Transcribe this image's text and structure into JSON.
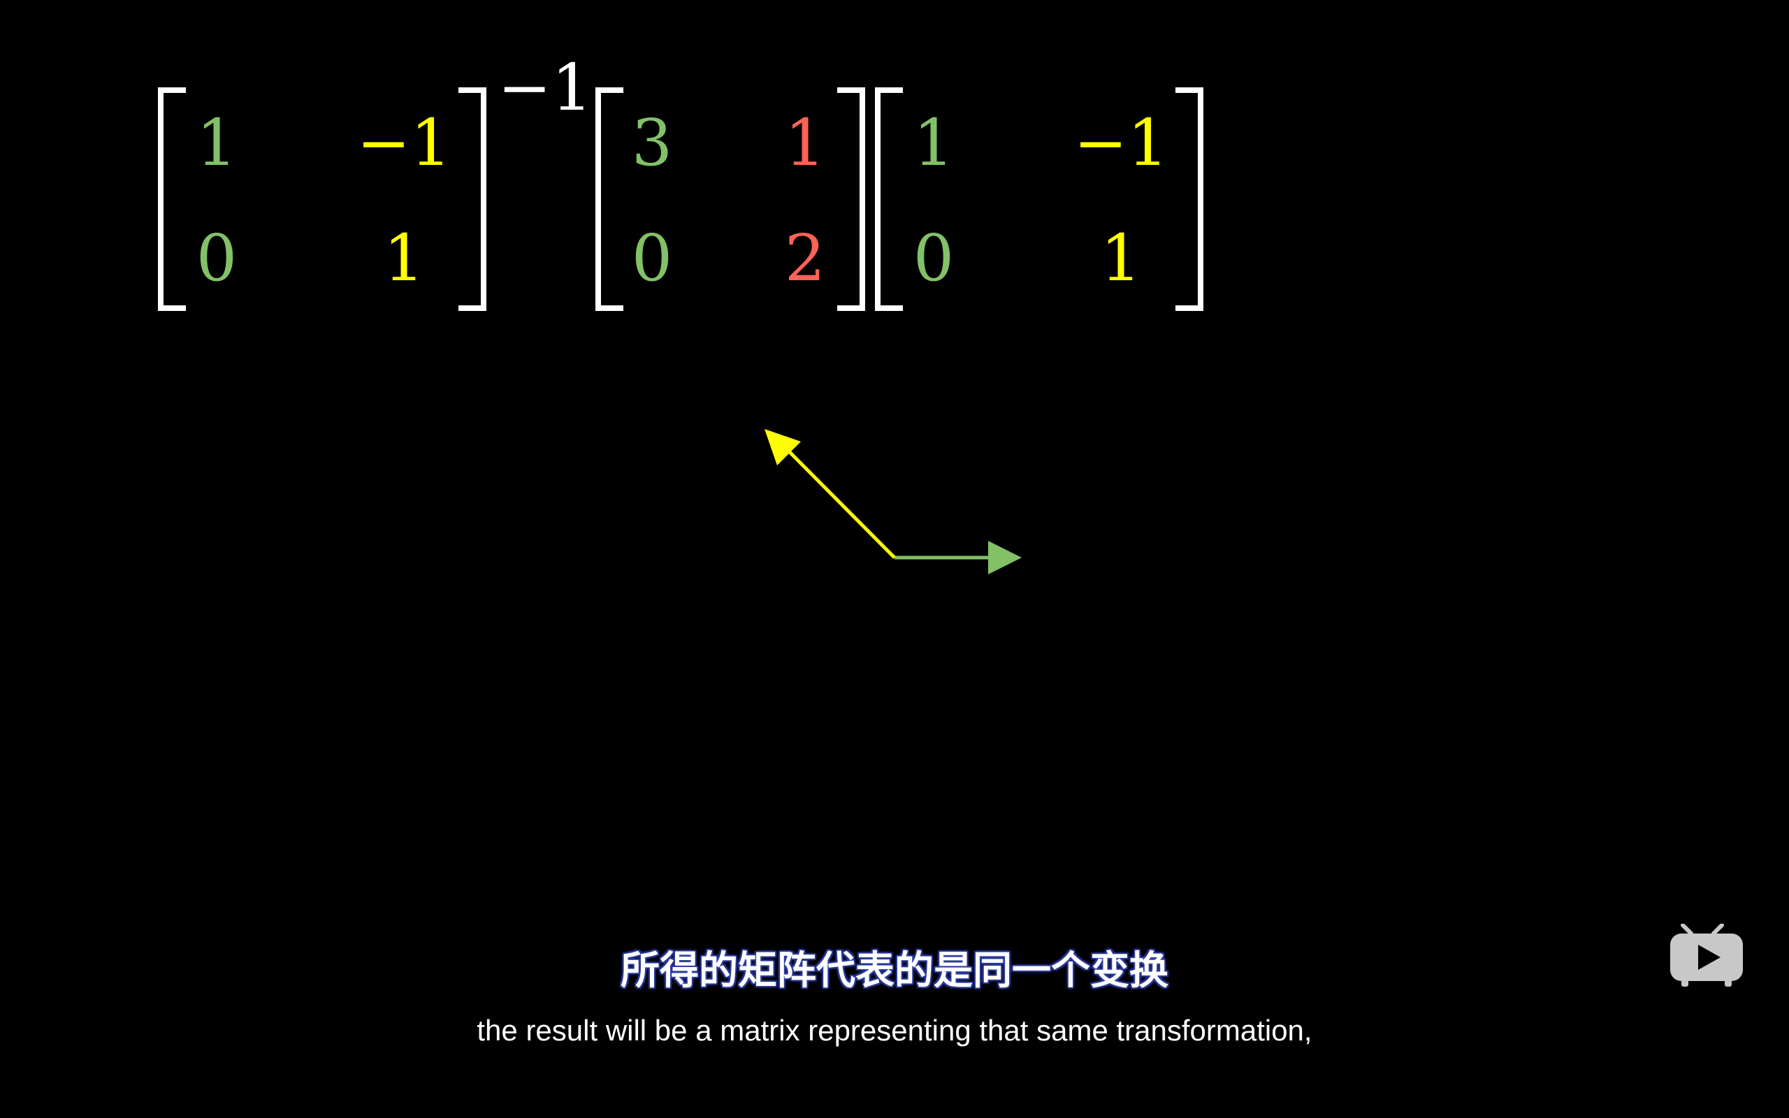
{
  "colors": {
    "background": "#000000",
    "bracket": "#ffffff",
    "green": "#83c167",
    "yellow": "#ffff00",
    "red": "#fc6255",
    "subtitle_outline": "#2a3b9a"
  },
  "equation": {
    "matrix_a": {
      "r1c1": "1",
      "r1c2": "−1",
      "r2c1": "0",
      "r2c2": "1"
    },
    "exponent": "−1",
    "matrix_m": {
      "r1c1": "3",
      "r1c2": "1",
      "r2c1": "0",
      "r2c2": "2"
    },
    "matrix_b": {
      "r1c1": "1",
      "r1c2": "−1",
      "r2c1": "0",
      "r2c2": "1"
    }
  },
  "vectors": [
    {
      "name": "green-basis-vector",
      "color": "#83c167",
      "dx": 1,
      "dy": 0
    },
    {
      "name": "yellow-basis-vector",
      "color": "#ffff00",
      "dx": -1,
      "dy": 1
    }
  ],
  "subtitles": {
    "chinese": "所得的矩阵代表的是同一个变换",
    "english": "the result will be a matrix representing that same transformation,"
  },
  "icons": {
    "player_logo": "tv-play-icon"
  }
}
